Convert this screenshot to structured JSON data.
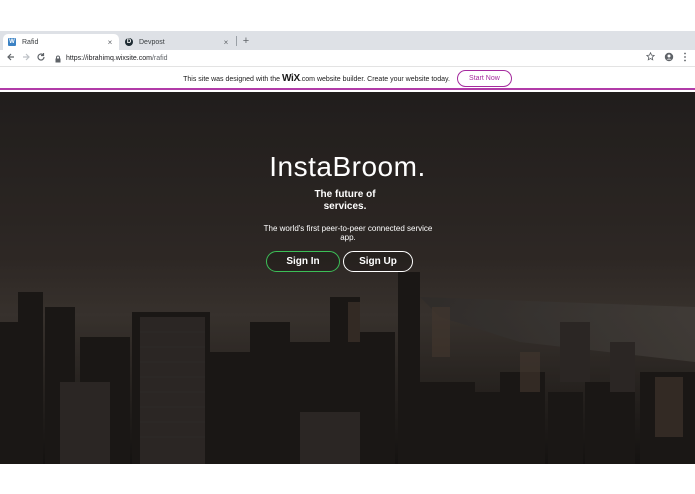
{
  "browser": {
    "tabs": [
      {
        "label": "Rafid",
        "active": true,
        "favicon": "wix-icon"
      },
      {
        "label": "Devpost",
        "active": false,
        "favicon": "devpost-icon"
      }
    ],
    "new_tab_symbol": "+",
    "close_symbol": "×",
    "url_host": "https://ibrahimq.wixsite.com",
    "url_path": "/rafid"
  },
  "wix_banner": {
    "text_before": "This site was designed with the",
    "logo_text": "WiX",
    "text_after": ".com website builder. Create your website today.",
    "button_label": "Start Now",
    "accent_color": "#b13ba8"
  },
  "hero": {
    "title": "InstaBroom.",
    "subtitle": "The future of services.",
    "description": "The world's first peer-to-peer connected service app.",
    "signin_label": "Sign In",
    "signup_label": "Sign Up",
    "signin_border_color": "#3cbf57"
  }
}
